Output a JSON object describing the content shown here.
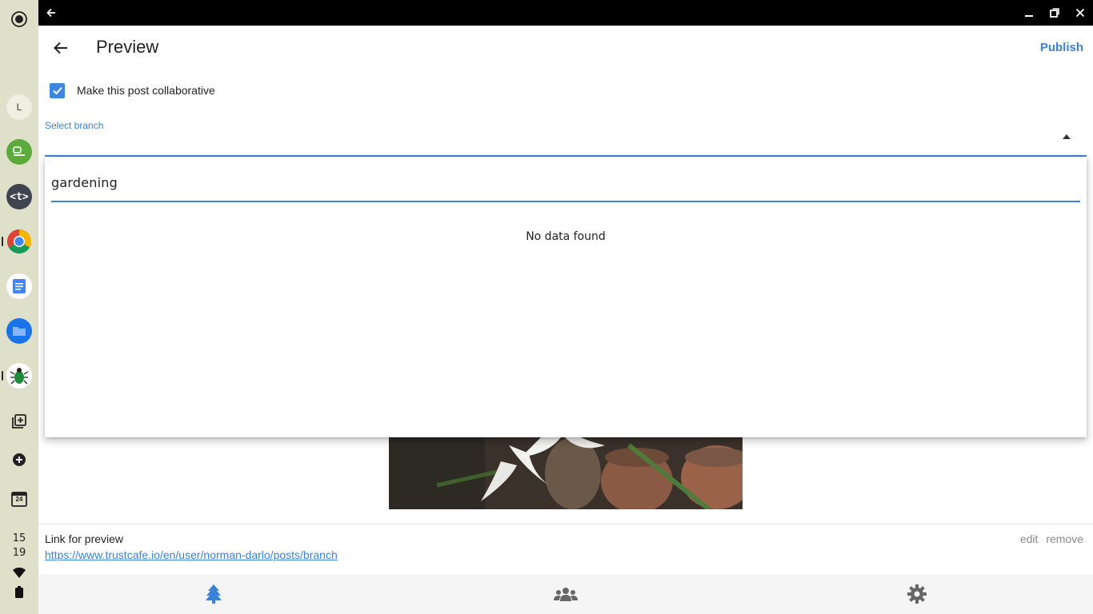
{
  "shelf": {
    "avatar_letter": "L",
    "clock_hour": "15",
    "clock_minute": "19",
    "calendar_day": "24"
  },
  "header": {
    "title": "Preview",
    "publish_label": "Publish"
  },
  "collab": {
    "label": "Make this post collaborative",
    "checked": true
  },
  "branch_select": {
    "label": "Select branch"
  },
  "dropdown": {
    "search_value": "gardening",
    "empty_text": "No data found"
  },
  "link": {
    "title": "Link for preview",
    "url": "https://www.trustcafe.io/en/user/norman-darlo/posts/branch",
    "edit_label": "edit",
    "remove_label": "remove"
  },
  "colors": {
    "accent": "#3b82d9",
    "shelf_bg": "#dfe0c9",
    "titlebar_bg": "#000000"
  }
}
